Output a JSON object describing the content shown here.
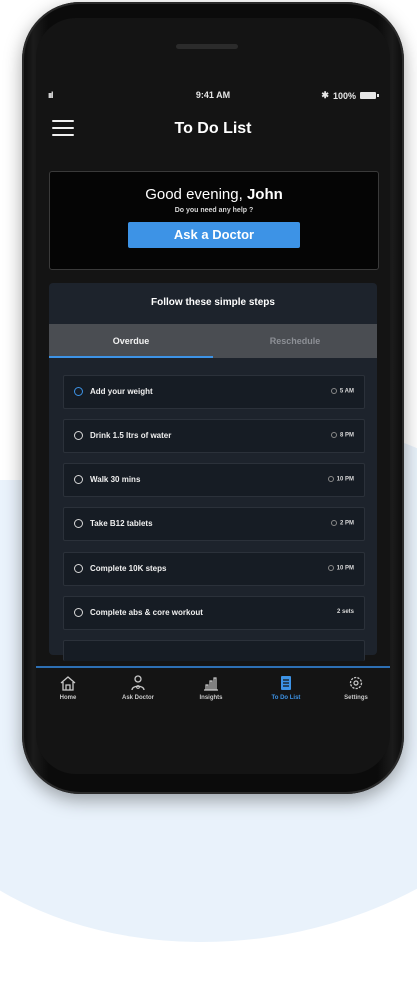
{
  "status_bar": {
    "signal": "ııl",
    "time": "9:41 AM",
    "battery": "100%",
    "bluetooth": "✱"
  },
  "header": {
    "title": "To Do List",
    "menu_icon": "hamburger-menu-icon"
  },
  "greeting": {
    "prefix": "Good evening, ",
    "name": "John",
    "subtitle": "Do you need any help ?",
    "button_label": "Ask a Doctor"
  },
  "steps": {
    "title": "Follow these simple steps",
    "tabs": [
      {
        "label": "Overdue",
        "active": true
      },
      {
        "label": "Reschedule",
        "active": false
      }
    ],
    "tasks": [
      {
        "label": "Add your weight",
        "time": "5 AM"
      },
      {
        "label": "Drink 1.5 ltrs of water",
        "time": "8 PM"
      },
      {
        "label": "Walk 30 mins",
        "time": "10 PM"
      },
      {
        "label": "Take B12 tablets",
        "time": "2 PM"
      },
      {
        "label": "Complete 10K steps",
        "time": "10 PM"
      },
      {
        "label": "Complete abs & core workout",
        "time": "2 sets"
      }
    ]
  },
  "bottom_nav": [
    {
      "label": "Home",
      "icon": "home-icon"
    },
    {
      "label": "Ask Doctor",
      "icon": "doctor-icon"
    },
    {
      "label": "Insights",
      "icon": "bar-chart-icon"
    },
    {
      "label": "To Do List",
      "icon": "clipboard-icon",
      "active": true
    },
    {
      "label": "Settings",
      "icon": "gear-icon"
    }
  ],
  "colors": {
    "accent": "#3d93e6",
    "background": "#141414",
    "panel": "#1d232c"
  }
}
